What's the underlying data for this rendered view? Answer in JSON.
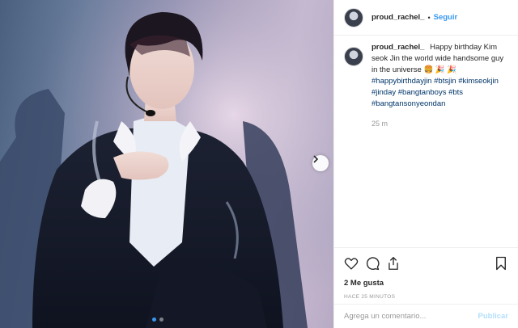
{
  "post": {
    "username": "proud_rachel_",
    "separator": "•",
    "follow_label": "Seguir",
    "icon": "avatar-circle"
  },
  "caption": {
    "username": "proud_rachel_",
    "text": "Happy birthday Kim seok Jin the world wide handsome guy in the universe",
    "emoji": "🍔 🎉 🎉",
    "hashtags": [
      "#happybirthdayjin",
      "#btsjin",
      "#kimseokjin",
      "#jinday",
      "#bangtanboys",
      "#bts",
      "#bangtansonyeondan"
    ],
    "time": "25 m"
  },
  "actions": {
    "icons": [
      "heart-icon",
      "comment-icon",
      "share-icon",
      "bookmark-icon"
    ]
  },
  "likes_label": "2 Me gusta",
  "posted_ago": "HACE 25 MINUTOS",
  "comment_input": {
    "placeholder": "Agrega un comentario...",
    "value": ""
  },
  "publish_label": "Publicar",
  "carousel": {
    "slide_count": 2,
    "active_slide": 1,
    "next_icon": "chevron-right-icon"
  },
  "colors": {
    "link_blue": "#3897f0",
    "hashtag": "#003569",
    "muted": "#999999",
    "publish_disabled": "#b2dffc"
  }
}
